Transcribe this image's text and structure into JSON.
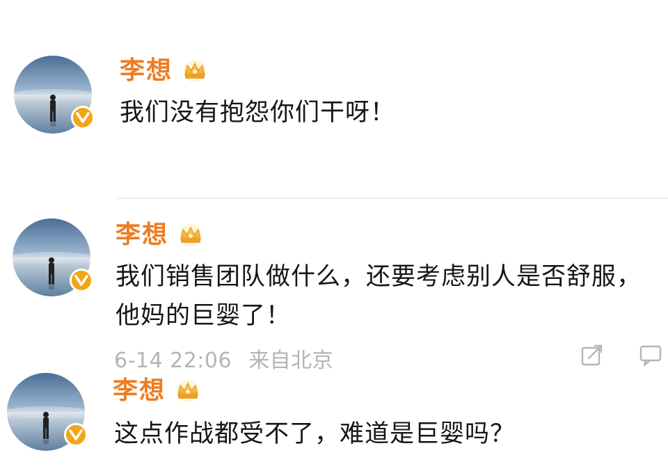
{
  "posts": [
    {
      "username": "李想",
      "lines": [
        "我们没有抱怨你们干呀！"
      ]
    },
    {
      "username": "李想",
      "lines": [
        "我们销售团队做什么，还要考虑别人是否舒服，",
        "他妈的巨婴了！"
      ],
      "meta": {
        "time": "6-14 22:06",
        "source": "来自北京"
      }
    },
    {
      "username": "李想",
      "lines": [
        "这点作战都受不了，难道是巨婴吗？"
      ]
    }
  ],
  "icons": {
    "verified": "verified-v-badge",
    "member": "crown-member-icon",
    "share": "share-icon",
    "comment": "comment-icon"
  },
  "colors": {
    "username": "#ec7d23",
    "badge": "#f2a516",
    "meta": "#b4b4b4"
  }
}
